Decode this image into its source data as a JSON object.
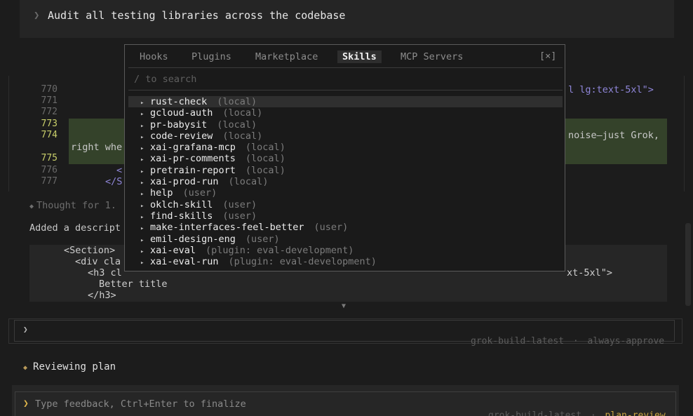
{
  "top_prompt": {
    "chevron": "❯",
    "text": "Audit all testing libraries across the codebase"
  },
  "code": {
    "lines": [
      {
        "num": "770",
        "text": "",
        "right": "l lg:text-5xl\">"
      },
      {
        "num": "771",
        "text": ""
      },
      {
        "num": "772",
        "text": ""
      },
      {
        "num": "773",
        "text": ""
      },
      {
        "num": "774",
        "text": "",
        "right": "noise—just Grok,"
      },
      {
        "num": "",
        "text": "right whe"
      },
      {
        "num": "775",
        "text": ""
      },
      {
        "num": "776",
        "text": "<"
      },
      {
        "num": "777",
        "text": "</S"
      }
    ]
  },
  "thought": {
    "icon": "diamond-icon",
    "text": "Thought for 1."
  },
  "added": {
    "text": "Added a descript"
  },
  "code_box": {
    "lines": [
      "<Section>",
      "<div cla",
      "<h3 cl",
      "Better title",
      "</h3>"
    ],
    "right": "xt-5xl\">"
  },
  "mid_prompt": {
    "chevron": "❯",
    "model": "grok-build-latest",
    "sep": "·",
    "mode": "always-approve"
  },
  "reviewing": {
    "icon": "diamond-icon",
    "text": "Reviewing plan"
  },
  "bottom_prompt": {
    "chevron": "❯",
    "placeholder": "Type feedback, Ctrl+Enter to finalize",
    "model": "grok-build-latest",
    "sep": "·",
    "mode": "plan-review"
  },
  "modal": {
    "tabs": [
      {
        "label": "Hooks",
        "active": false
      },
      {
        "label": "Plugins",
        "active": false
      },
      {
        "label": "Marketplace",
        "active": false
      },
      {
        "label": "Skills",
        "active": true
      },
      {
        "label": "MCP Servers",
        "active": false
      }
    ],
    "close_label": "[×]",
    "search_placeholder": "/ to search",
    "items": [
      {
        "name": "rust-check",
        "source": "(local)",
        "selected": true
      },
      {
        "name": "gcloud-auth",
        "source": "(local)"
      },
      {
        "name": "pr-babysit",
        "source": "(local)"
      },
      {
        "name": "code-review",
        "source": "(local)"
      },
      {
        "name": "xai-grafana-mcp",
        "source": "(local)"
      },
      {
        "name": "xai-pr-comments",
        "source": "(local)"
      },
      {
        "name": "pretrain-report",
        "source": "(local)"
      },
      {
        "name": "xai-prod-run",
        "source": "(local)"
      },
      {
        "name": "help",
        "source": "(user)"
      },
      {
        "name": "oklch-skill",
        "source": "(user)"
      },
      {
        "name": "find-skills",
        "source": "(user)"
      },
      {
        "name": "make-interfaces-feel-better",
        "source": "(user)"
      },
      {
        "name": "emil-design-eng",
        "source": "(user)"
      },
      {
        "name": "xai-eval",
        "source": "(plugin: eval-development)"
      },
      {
        "name": "xai-eval-run",
        "source": "(plugin: eval-development)"
      }
    ],
    "bullet": "▸"
  },
  "colors": {
    "accent": "#e2b84c",
    "diff_highlight": "#34422a",
    "tag": "#8f86d9"
  }
}
